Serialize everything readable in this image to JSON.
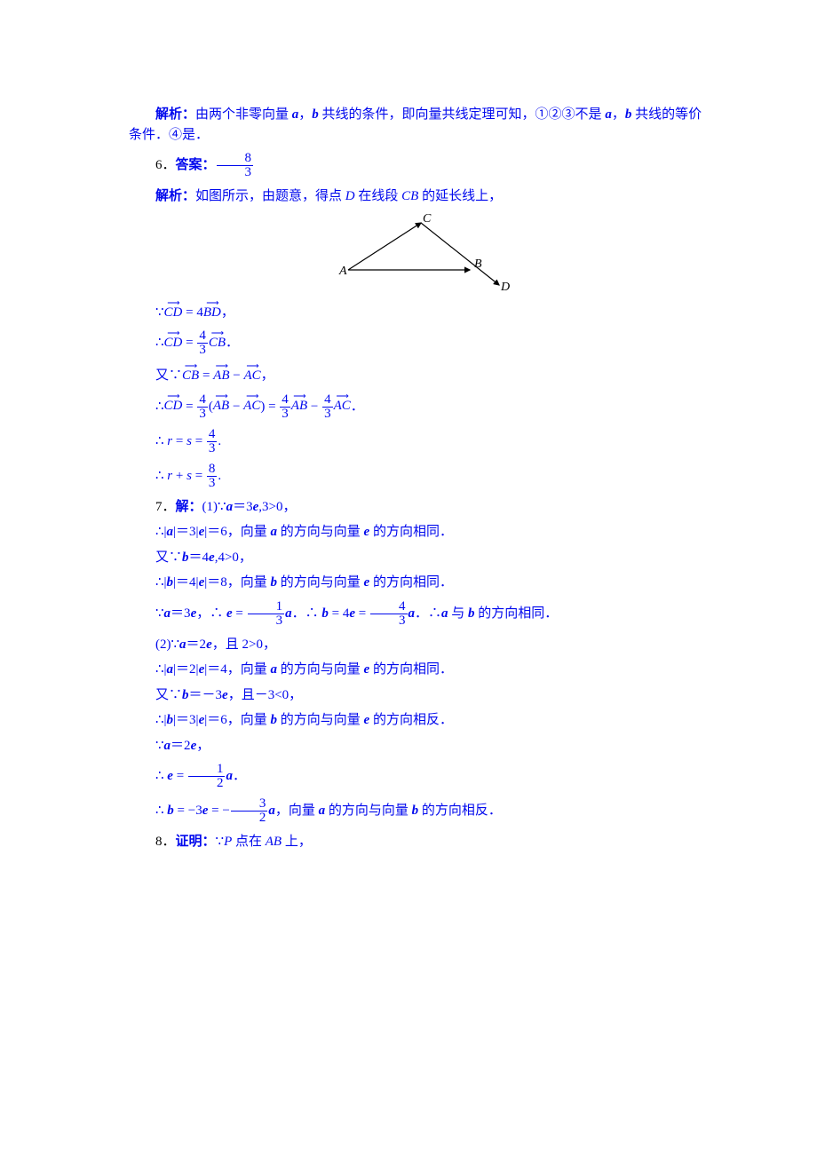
{
  "p5": {
    "analysis_label": "解析：",
    "analysis_text1": "由两个非零向量",
    "a": "a",
    "comma": "，",
    "b": "b",
    "analysis_text2": "共线的条件，即向量共线定理可知，①②③不是",
    "analysis_text3": "共线的等价条件．④是．"
  },
  "q6": {
    "number": "6．",
    "ans_label": "答案：",
    "ans_frac_n": "8",
    "ans_frac_d": "3",
    "analysis_label": "解析：",
    "analysis_text": "如图所示，由题意，得点",
    "D": "D",
    "after_D": "在线段",
    "CB": "CB",
    "after_CB": "的延长线上，",
    "diagram": {
      "A": "A",
      "B": "B",
      "C": "C",
      "D": "D"
    },
    "eq1_l": "CD",
    "eq1_r": "BD",
    "eq2_l": "CD",
    "eq2_frac_n": "4",
    "eq2_frac_d": "3",
    "eq2_r": "CB",
    "eq3_pre": "又∵",
    "eq3_l": "CB",
    "eq3_a": "AB",
    "eq3_b": "AC",
    "eq4_l": "CD",
    "eq4_fn": "4",
    "eq4_fd": "3",
    "eq4_a": "AB",
    "eq4_b": "AC",
    "eq4_a2": "AB",
    "eq4_b2": "AC",
    "rs": "r",
    "ss": "s",
    "rs_val_n": "4",
    "rs_val_d": "3",
    "sum_n": "8",
    "sum_d": "3"
  },
  "q7": {
    "number": "7．",
    "solve": "解：",
    "part1_label": "(1)",
    "a": "a",
    "b": "b",
    "e": "e",
    "p1_l1_a": "∵",
    "p1_l1_b": "＝3",
    "p1_l1_c": ",3>0，",
    "p1_l2_a": "∴|",
    "p1_l2_b": "|＝3|",
    "p1_l2_c": "|＝6，向量",
    "p1_l2_d": "的方向与向量",
    "p1_l2_e": "的方向相同．",
    "p1_l3_a": "又∵",
    "p1_l3_b": "＝4",
    "p1_l3_c": ",4>0，",
    "p1_l4_a": "∴|",
    "p1_l4_b": "|＝4|",
    "p1_l4_c": "|＝8，向量",
    "p1_l4_d": "的方向与向量",
    "p1_l4_e": "的方向相同．",
    "p1_l5_a": "∵",
    "p1_l5_b": "＝3",
    "p1_l5_c": "，∴",
    "p1_l5_fn1": "1",
    "p1_l5_fd1": "3",
    "p1_l5_d": "．∴",
    "p1_l5_fn2": "4",
    "p1_l5_fd2": "3",
    "p1_l5_e": "．∴",
    "p1_l5_f": "与",
    "p1_l5_g": "的方向相同．",
    "part2_label": "(2)",
    "p2_l1_a": "∵",
    "p2_l1_b": "＝2",
    "p2_l1_c": "，且 2>0，",
    "p2_l2_a": "∴|",
    "p2_l2_b": "|＝2|",
    "p2_l2_c": "|＝4，向量",
    "p2_l2_d": "的方向与向量",
    "p2_l2_e": "的方向相同．",
    "p2_l3_a": "又∵",
    "p2_l3_b": "＝－3",
    "p2_l3_c": "，且－3<0，",
    "p2_l4_a": "∴|",
    "p2_l4_b": "|＝3|",
    "p2_l4_c": "|＝6，向量",
    "p2_l4_d": "的方向与向量",
    "p2_l4_e": "的方向相反．",
    "p2_l5_a": "∵",
    "p2_l5_b": "＝2",
    "p2_l5_c": "，",
    "p2_l6_a": "∴",
    "p2_l6_fn": "1",
    "p2_l6_fd": "2",
    "p2_l6_b": "．",
    "p2_l7_a": "∴",
    "p2_l7_neg": "－3",
    "p2_l7_fn": "3",
    "p2_l7_fd": "2",
    "p2_l7_b": "，向量",
    "p2_l7_c": "的方向与向量",
    "p2_l7_d": "的方向相反．"
  },
  "q8": {
    "number": "8．",
    "proof": "证明：",
    "text1": "∵",
    "P": "P",
    "text2": "点在",
    "AB": "AB",
    "text3": "上，"
  }
}
